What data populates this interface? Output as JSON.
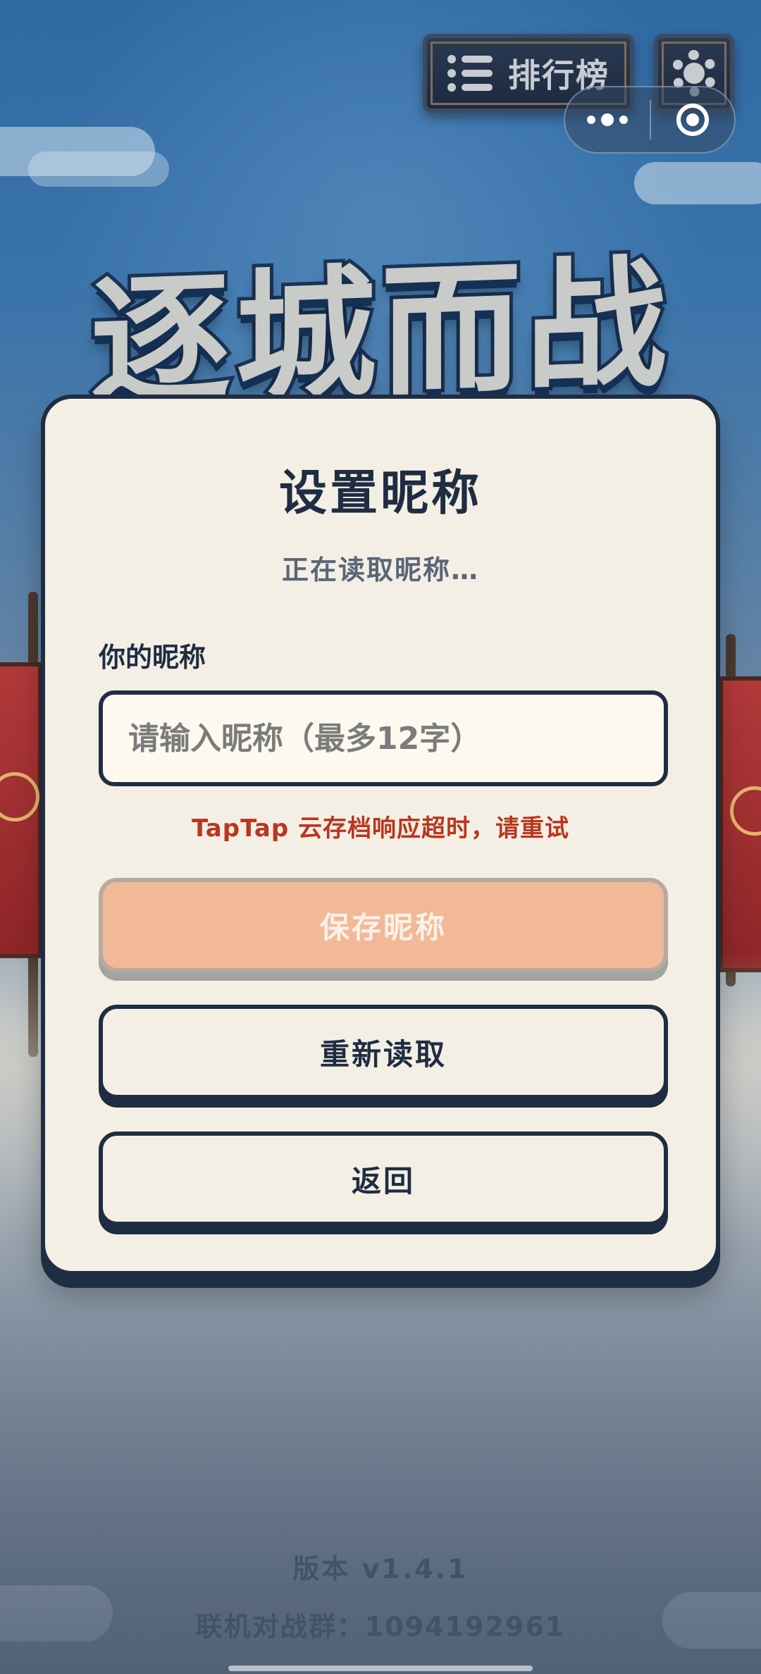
{
  "game": {
    "logo_text": "逐城而战"
  },
  "top_bar": {
    "leaderboard_label": "排行榜",
    "leaderboard_icon": "list-icon",
    "settings_icon": "gear-icon"
  },
  "capsule": {
    "more_icon": "more-dots-icon",
    "close_icon": "target-circle-icon"
  },
  "dialog": {
    "title": "设置昵称",
    "status": "正在读取昵称…",
    "field_label": "你的昵称",
    "input": {
      "value": "",
      "placeholder": "请输入昵称（最多12字）"
    },
    "error_message": "TapTap 云存档响应超时，请重试",
    "save_button": "保存昵称",
    "reload_button": "重新读取",
    "back_button": "返回"
  },
  "footer": {
    "version": "版本 v1.4.1",
    "group": "联机对战群：1094192961"
  },
  "colors": {
    "panel_bg": "#f4efe4",
    "navy": "#1f2d43",
    "save_disabled": "#f1b998",
    "error": "#b9361f",
    "sky_top": "#2f6aa3"
  }
}
